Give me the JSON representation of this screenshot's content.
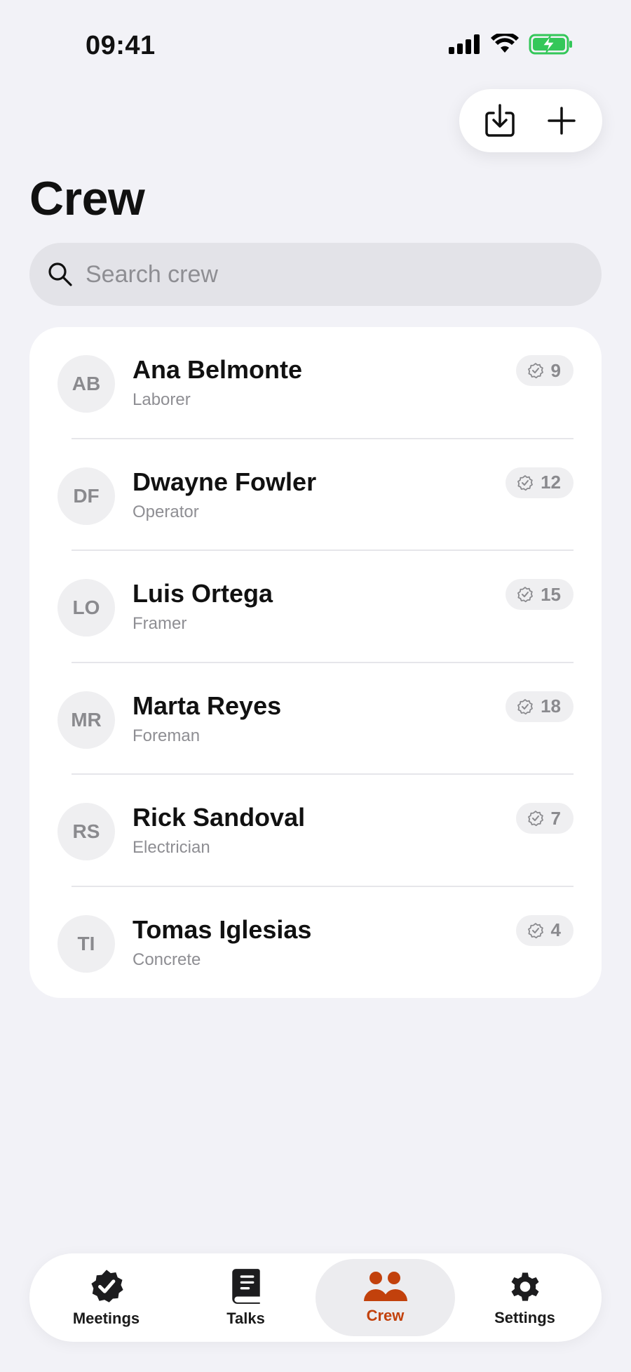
{
  "status_bar": {
    "time": "09:41"
  },
  "header": {
    "title": "Crew"
  },
  "search": {
    "placeholder": "Search crew",
    "value": ""
  },
  "crew": [
    {
      "initials": "AB",
      "name": "Ana Belmonte",
      "role": "Laborer",
      "count": "9"
    },
    {
      "initials": "DF",
      "name": "Dwayne Fowler",
      "role": "Operator",
      "count": "12"
    },
    {
      "initials": "LO",
      "name": "Luis Ortega",
      "role": "Framer",
      "count": "15"
    },
    {
      "initials": "MR",
      "name": "Marta Reyes",
      "role": "Foreman",
      "count": "18"
    },
    {
      "initials": "RS",
      "name": "Rick Sandoval",
      "role": "Electrician",
      "count": "7"
    },
    {
      "initials": "TI",
      "name": "Tomas Iglesias",
      "role": "Concrete",
      "count": "4"
    }
  ],
  "tabs": [
    {
      "label": "Meetings",
      "icon": "seal-check-icon"
    },
    {
      "label": "Talks",
      "icon": "book-icon"
    },
    {
      "label": "Crew",
      "icon": "people-icon",
      "active": true
    },
    {
      "label": "Settings",
      "icon": "gear-icon"
    }
  ],
  "colors": {
    "accent": "#c2410c",
    "battery": "#34c759",
    "background": "#f2f2f7"
  }
}
